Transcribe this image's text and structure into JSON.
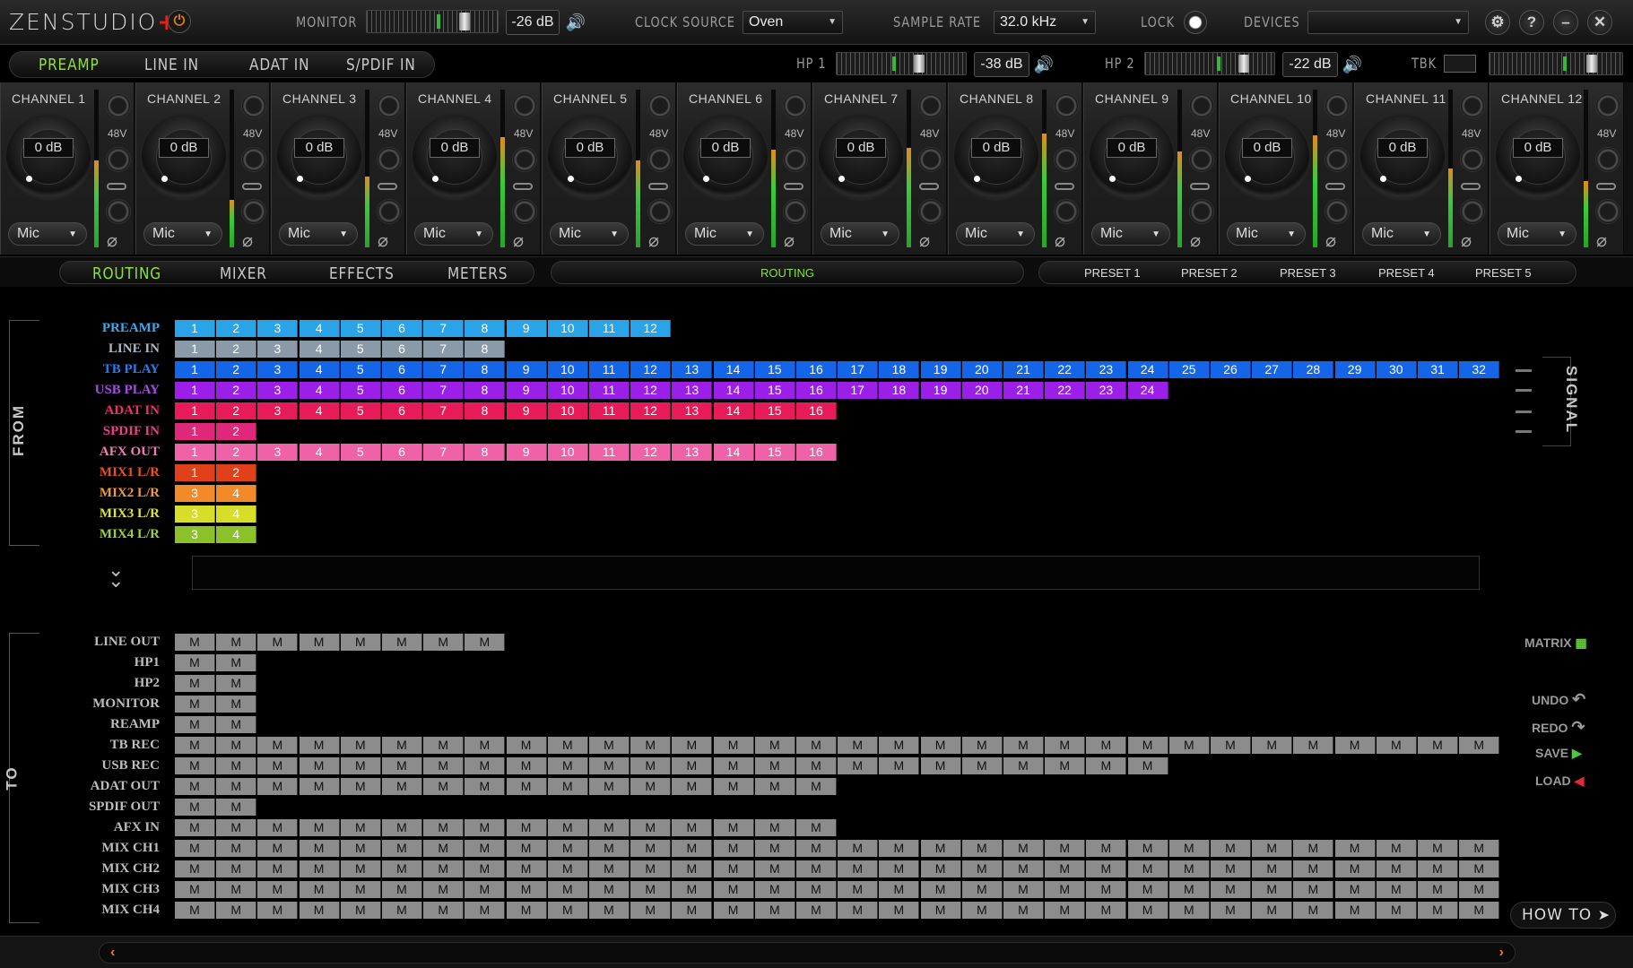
{
  "header": {
    "logo_text": "ZENSTUDIO",
    "logo_plus": "+",
    "monitor_label": "MONITOR",
    "monitor_db": "-26 dB",
    "clock_source_label": "CLOCK SOURCE",
    "clock_source_value": "Oven",
    "sample_rate_label": "SAMPLE RATE",
    "sample_rate_value": "32.0 kHz",
    "lock_label": "LOCK",
    "devices_label": "DEVICES",
    "devices_value": "",
    "icons": [
      "gear-icon",
      "help-icon",
      "minimize-icon",
      "close-icon",
      "power-icon"
    ]
  },
  "input_tabs": [
    "PREAMP",
    "LINE IN",
    "ADAT IN",
    "S/PDIF IN"
  ],
  "active_input_tab": "PREAMP",
  "hp1": {
    "label": "HP 1",
    "db": "-38 dB"
  },
  "hp2": {
    "label": "HP 2",
    "db": "-22 dB"
  },
  "tbk": {
    "label": "TBK"
  },
  "channels": [
    {
      "name": "CHANNEL 1",
      "gain": "0 dB",
      "phantom": "48V",
      "source": "Mic"
    },
    {
      "name": "CHANNEL 2",
      "gain": "0 dB",
      "phantom": "48V",
      "source": "Mic"
    },
    {
      "name": "CHANNEL 3",
      "gain": "0 dB",
      "phantom": "48V",
      "source": "Mic"
    },
    {
      "name": "CHANNEL 4",
      "gain": "0 dB",
      "phantom": "48V",
      "source": "Mic"
    },
    {
      "name": "CHANNEL 5",
      "gain": "0 dB",
      "phantom": "48V",
      "source": "Mic"
    },
    {
      "name": "CHANNEL 6",
      "gain": "0 dB",
      "phantom": "48V",
      "source": "Mic"
    },
    {
      "name": "CHANNEL 7",
      "gain": "0 dB",
      "phantom": "48V",
      "source": "Mic"
    },
    {
      "name": "CHANNEL 8",
      "gain": "0 dB",
      "phantom": "48V",
      "source": "Mic"
    },
    {
      "name": "CHANNEL 9",
      "gain": "0 dB",
      "phantom": "48V",
      "source": "Mic"
    },
    {
      "name": "CHANNEL 10",
      "gain": "0 dB",
      "phantom": "48V",
      "source": "Mic"
    },
    {
      "name": "CHANNEL 11",
      "gain": "0 dB",
      "phantom": "48V",
      "source": "Mic"
    },
    {
      "name": "CHANNEL 12",
      "gain": "0 dB",
      "phantom": "48V",
      "source": "Mic"
    }
  ],
  "section_tabs": [
    "ROUTING",
    "MIXER",
    "EFFECTS",
    "METERS"
  ],
  "active_section_tab": "ROUTING",
  "section_title": "ROUTING",
  "presets": [
    "PRESET 1",
    "PRESET 2",
    "PRESET 3",
    "PRESET 4",
    "PRESET 5"
  ],
  "from_label": "FROM",
  "to_label": "TO",
  "signal_label": "SIGNAL",
  "from_rows": [
    {
      "label": "PREAMP",
      "color": "#2aa3e8",
      "label_color": "#3aa9f0",
      "cells": [
        "1",
        "2",
        "3",
        "4",
        "5",
        "6",
        "7",
        "8",
        "9",
        "10",
        "11",
        "12"
      ]
    },
    {
      "label": "LINE IN",
      "color": "#8a9aa8",
      "label_color": "#aab8c4",
      "cells": [
        "1",
        "2",
        "3",
        "4",
        "5",
        "6",
        "7",
        "8"
      ]
    },
    {
      "label": "TB PLAY",
      "color": "#1565e8",
      "label_color": "#2a7cf2",
      "cells": [
        "1",
        "2",
        "3",
        "4",
        "5",
        "6",
        "7",
        "8",
        "9",
        "10",
        "11",
        "12",
        "13",
        "14",
        "15",
        "16",
        "17",
        "18",
        "19",
        "20",
        "21",
        "22",
        "23",
        "24",
        "25",
        "26",
        "27",
        "28",
        "29",
        "30",
        "31",
        "32"
      ]
    },
    {
      "label": "USB PLAY",
      "color": "#9b1fe6",
      "label_color": "#a64ae8",
      "cells": [
        "1",
        "2",
        "3",
        "4",
        "5",
        "6",
        "7",
        "8",
        "9",
        "10",
        "11",
        "12",
        "13",
        "14",
        "15",
        "16",
        "17",
        "18",
        "19",
        "20",
        "21",
        "22",
        "23",
        "24"
      ]
    },
    {
      "label": "ADAT IN",
      "color": "#e81b5a",
      "label_color": "#f0306a",
      "cells": [
        "1",
        "2",
        "3",
        "4",
        "5",
        "6",
        "7",
        "8",
        "9",
        "10",
        "11",
        "12",
        "13",
        "14",
        "15",
        "16"
      ]
    },
    {
      "label": "SPDIF IN",
      "color": "#e0287a",
      "label_color": "#e9408a",
      "cells": [
        "1",
        "2"
      ]
    },
    {
      "label": "AFX OUT",
      "color": "#f062a8",
      "label_color": "#f37ab8",
      "cells": [
        "1",
        "2",
        "3",
        "4",
        "5",
        "6",
        "7",
        "8",
        "9",
        "10",
        "11",
        "12",
        "13",
        "14",
        "15",
        "16"
      ]
    },
    {
      "label": "MIX1 L/R",
      "color": "#e0411a",
      "label_color": "#e8541f",
      "cells": [
        "1",
        "2"
      ]
    },
    {
      "label": "MIX2 L/R",
      "color": "#f28a2a",
      "label_color": "#f39a3a",
      "cells": [
        "3",
        "4"
      ]
    },
    {
      "label": "MIX3 L/R",
      "color": "#d6de2a",
      "label_color": "#dce43a",
      "cells": [
        "3",
        "4"
      ]
    },
    {
      "label": "MIX4 L/R",
      "color": "#8bc22a",
      "label_color": "#9ad23a",
      "cells": [
        "3",
        "4"
      ]
    }
  ],
  "to_rows": [
    {
      "label": "LINE OUT",
      "count": 8
    },
    {
      "label": "HP1",
      "count": 2
    },
    {
      "label": "HP2",
      "count": 2
    },
    {
      "label": "MONITOR",
      "count": 2
    },
    {
      "label": "REAMP",
      "count": 2
    },
    {
      "label": "TB REC",
      "count": 32
    },
    {
      "label": "USB REC",
      "count": 24
    },
    {
      "label": "ADAT OUT",
      "count": 16
    },
    {
      "label": "SPDIF OUT",
      "count": 2
    },
    {
      "label": "AFX IN",
      "count": 16
    },
    {
      "label": "MIX CH1",
      "count": 32
    },
    {
      "label": "MIX CH2",
      "count": 32
    },
    {
      "label": "MIX CH3",
      "count": 32
    },
    {
      "label": "MIX CH4",
      "count": 32
    }
  ],
  "cell_mute_text": "M",
  "side_buttons": {
    "matrix": "MATRIX",
    "undo": "UNDO",
    "redo": "REDO",
    "save": "SAVE",
    "load": "LOAD",
    "howto": "HOW TO"
  }
}
